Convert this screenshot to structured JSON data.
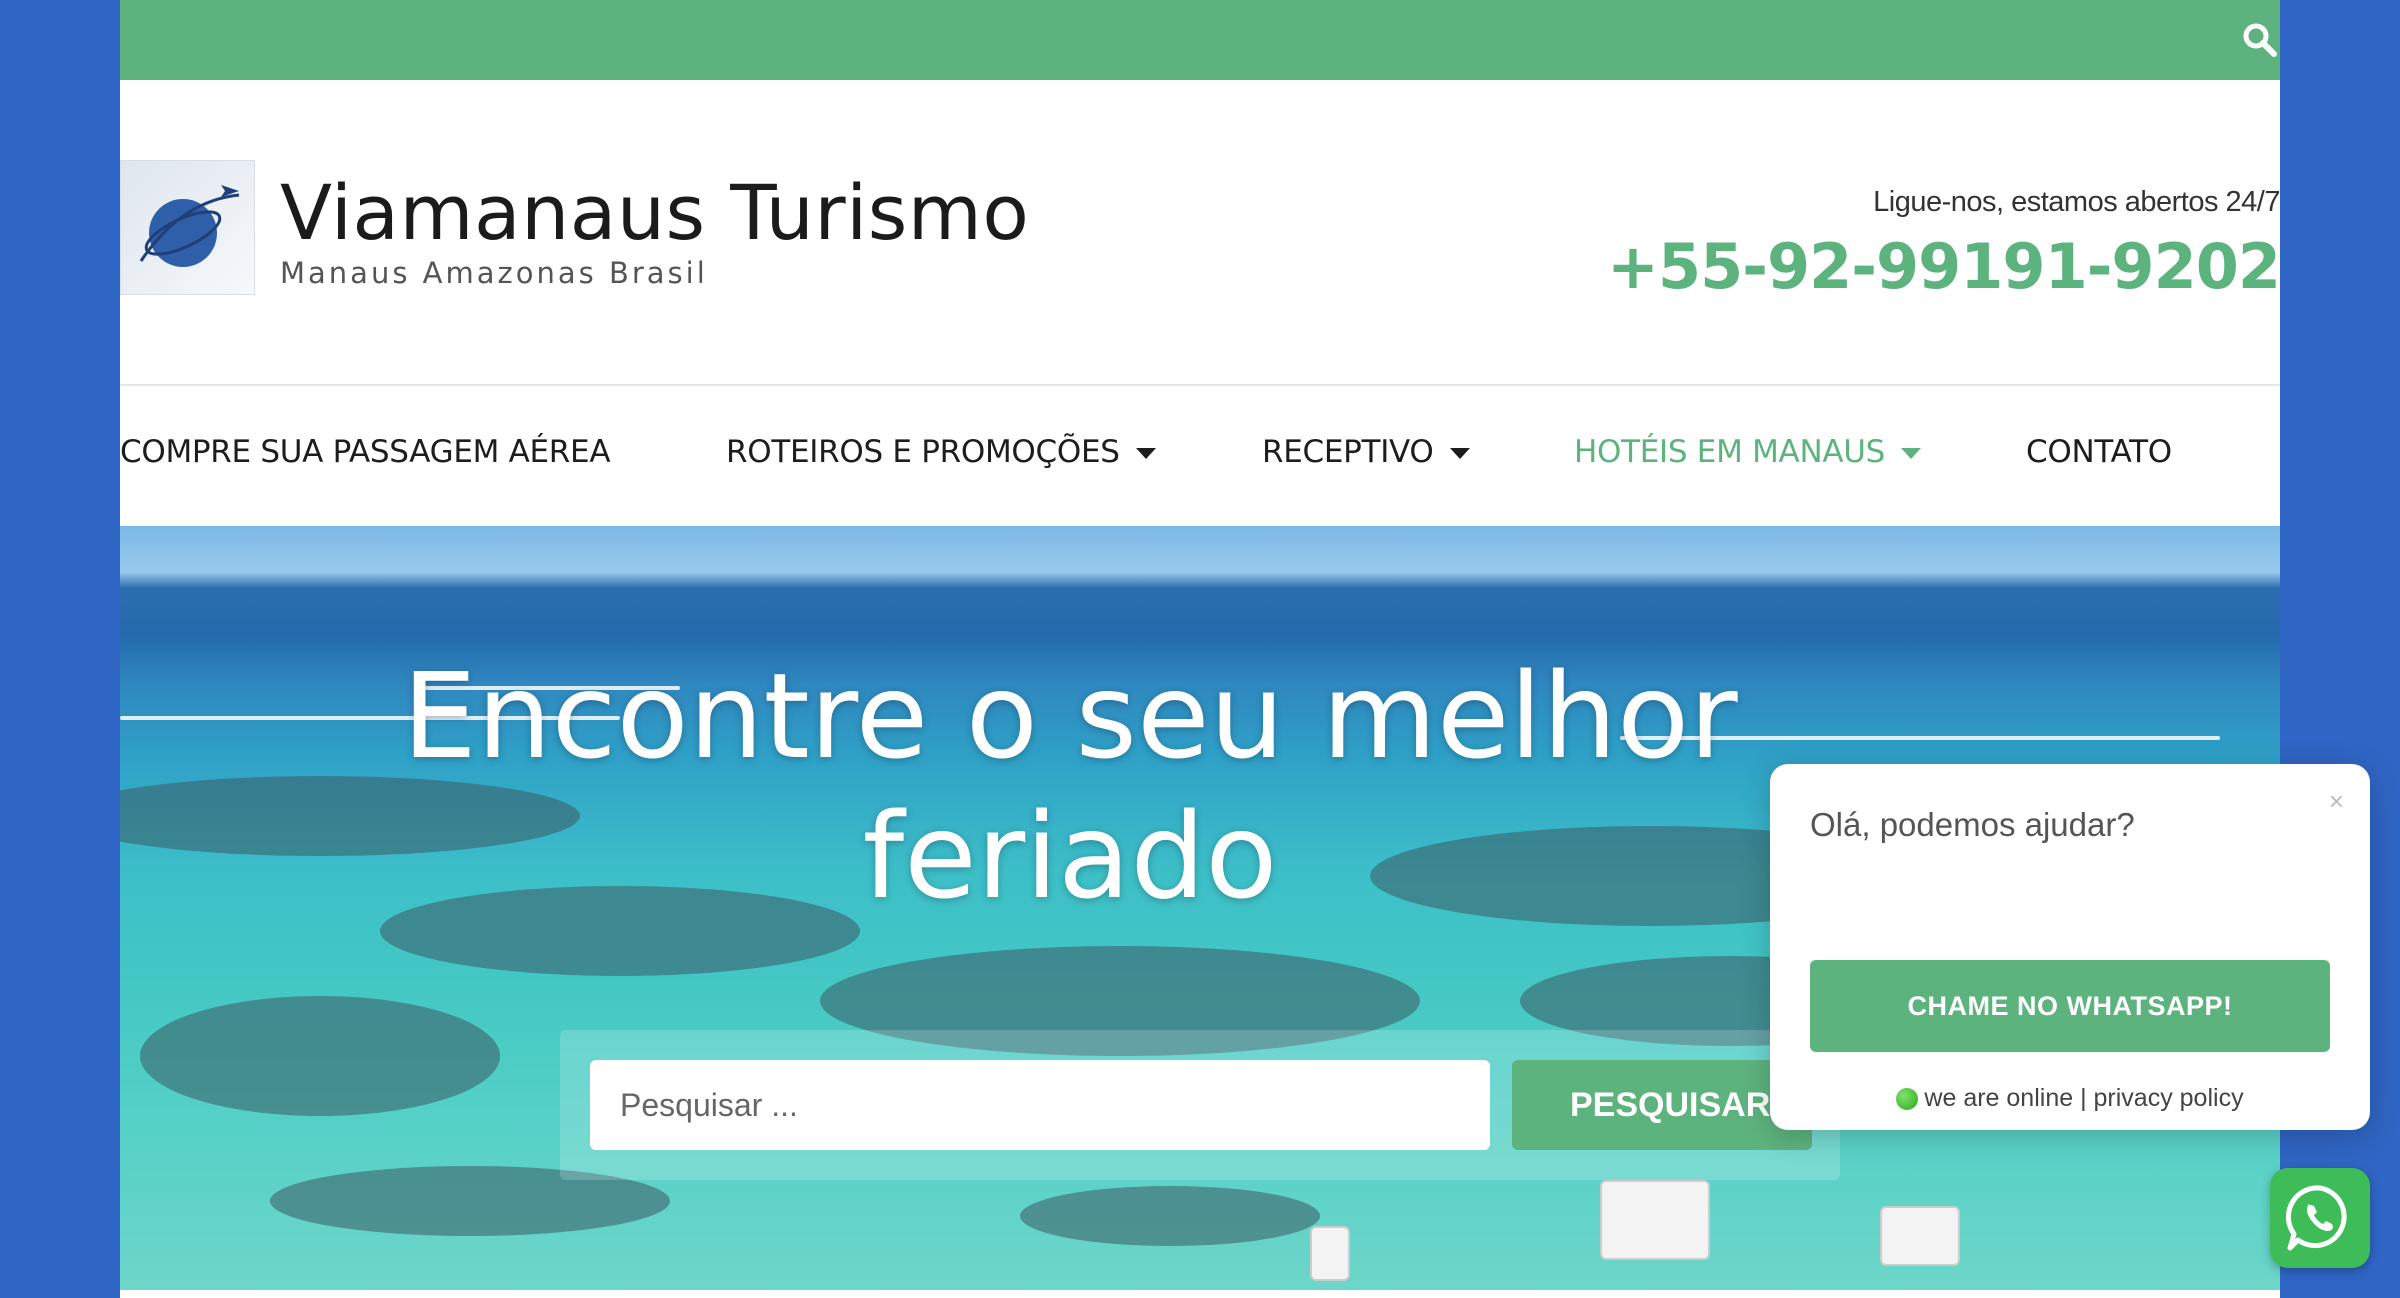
{
  "colors": {
    "accent": "#5db37e",
    "background": "#2f65c4",
    "text": "#1d1d1d"
  },
  "topbar": {
    "search_icon": "search-icon"
  },
  "header": {
    "site_title": "Viamanaus Turismo",
    "tagline": "Manaus Amazonas Brasil",
    "logo_icon": "globe-airplane-logo",
    "call_text": "Ligue-nos, estamos abertos 24/7",
    "phone": "+55-92-99191-9202"
  },
  "nav": {
    "items": [
      {
        "label": "COMPRE SUA PASSAGEM AÉREA",
        "dropdown": false,
        "active": false
      },
      {
        "label": "ROTEIROS E PROMOÇÕES",
        "dropdown": true,
        "active": false
      },
      {
        "label": "RECEPTIVO",
        "dropdown": true,
        "active": false
      },
      {
        "label": "HOTÉIS EM MANAUS",
        "dropdown": true,
        "active": true
      },
      {
        "label": "CONTATO",
        "dropdown": false,
        "active": false
      }
    ]
  },
  "hero": {
    "title_line1": "Encontre o seu melhor",
    "title_line2": "feriado",
    "search_placeholder": "Pesquisar ...",
    "search_button": "PESQUISAR"
  },
  "chat": {
    "greeting": "Olá, podemos ajudar?",
    "close": "×",
    "cta": "CHAME NO WHATSAPP!",
    "status": "we are online | privacy policy",
    "float_icon": "whatsapp-icon"
  }
}
